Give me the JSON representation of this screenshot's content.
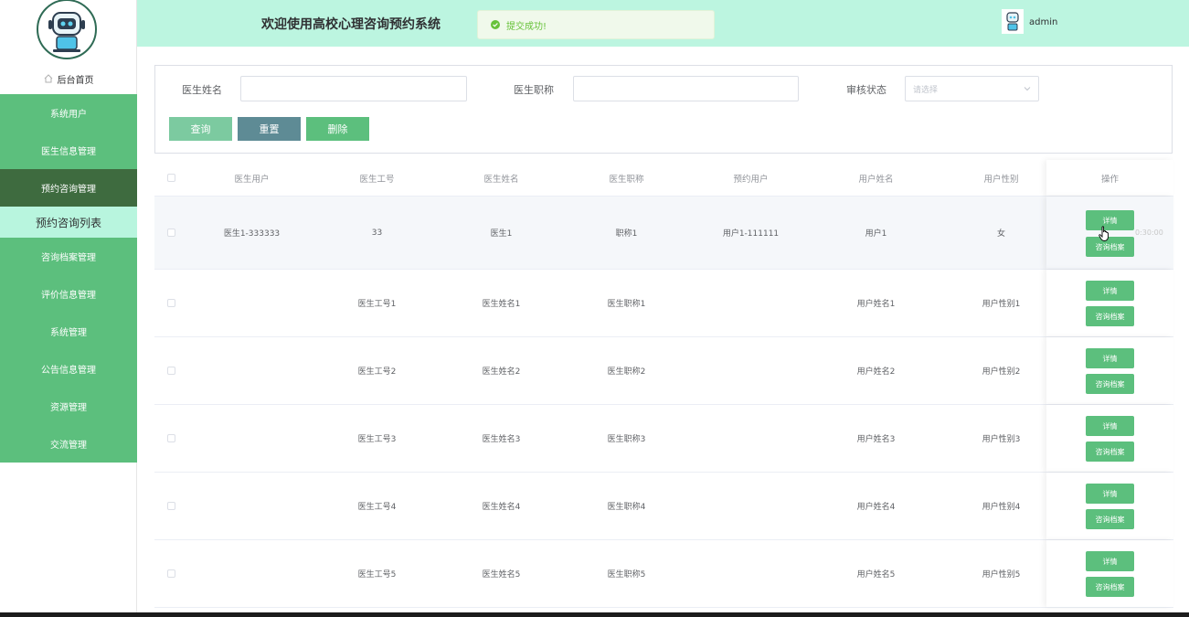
{
  "app": {
    "title": "欢迎使用高校心理咨询预约系统",
    "user": "admin"
  },
  "toast": {
    "text": "提交成功!"
  },
  "sidebar": {
    "home": "后台首页",
    "items": [
      {
        "label": "系统用户"
      },
      {
        "label": "医生信息管理"
      },
      {
        "label": "预约咨询管理"
      },
      {
        "label": "预约咨询列表"
      },
      {
        "label": "咨询档案管理"
      },
      {
        "label": "评价信息管理"
      },
      {
        "label": "系统管理"
      },
      {
        "label": "公告信息管理"
      },
      {
        "label": "资源管理"
      },
      {
        "label": "交流管理"
      }
    ]
  },
  "search": {
    "doctor_name_label": "医生姓名",
    "doctor_name_value": "",
    "doctor_title_label": "医生职称",
    "doctor_title_value": "",
    "status_label": "审核状态",
    "status_placeholder": "请选择",
    "query_button": "查询",
    "reset_button": "重置",
    "delete_button": "删除"
  },
  "table": {
    "headers": [
      "医生用户",
      "医生工号",
      "医生姓名",
      "医生职称",
      "预约用户",
      "用户姓名",
      "用户性别",
      "操作"
    ],
    "rows": [
      {
        "doctor_user": "医生1-333333",
        "doctor_id": "33",
        "doctor_name": "医生1",
        "doctor_title": "职称1",
        "booking_user": "用户1-111111",
        "user_name": "用户1",
        "user_gender": "女"
      },
      {
        "doctor_user": "",
        "doctor_id": "医生工号1",
        "doctor_name": "医生姓名1",
        "doctor_title": "医生职称1",
        "booking_user": "",
        "user_name": "用户姓名1",
        "user_gender": "用户性别1"
      },
      {
        "doctor_user": "",
        "doctor_id": "医生工号2",
        "doctor_name": "医生姓名2",
        "doctor_title": "医生职称2",
        "booking_user": "",
        "user_name": "用户姓名2",
        "user_gender": "用户性别2"
      },
      {
        "doctor_user": "",
        "doctor_id": "医生工号3",
        "doctor_name": "医生姓名3",
        "doctor_title": "医生职称3",
        "booking_user": "",
        "user_name": "用户姓名3",
        "user_gender": "用户性别3"
      },
      {
        "doctor_user": "",
        "doctor_id": "医生工号4",
        "doctor_name": "医生姓名4",
        "doctor_title": "医生职称4",
        "booking_user": "",
        "user_name": "用户姓名4",
        "user_gender": "用户性别4"
      },
      {
        "doctor_user": "",
        "doctor_id": "医生工号5",
        "doctor_name": "医生姓名5",
        "doctor_title": "医生职称5",
        "booking_user": "",
        "user_name": "用户姓名5",
        "user_gender": "用户性别5"
      }
    ],
    "detail_button": "详情",
    "archive_button": "咨询档案",
    "hidden_time": "0:30:00"
  },
  "colors": {
    "primary": "#5cbf7d",
    "header_bg": "#bcf5e0",
    "active_menu": "#3e6b3f",
    "submenu_bg": "#b8f5de",
    "query_btn": "#7ccaa0",
    "reset_btn": "#5e8b95"
  }
}
